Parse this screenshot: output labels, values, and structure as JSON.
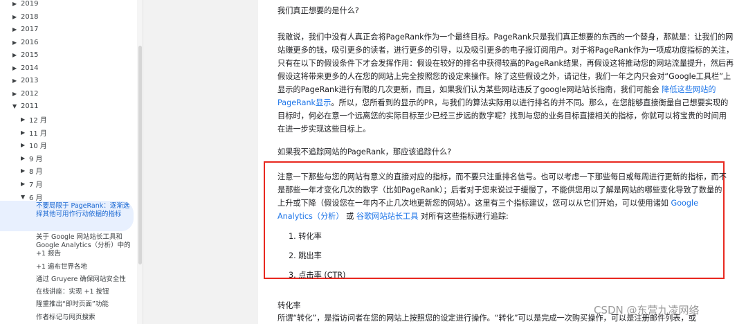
{
  "sidebar": {
    "years": [
      {
        "label": "2019",
        "expanded": false
      },
      {
        "label": "2018",
        "expanded": false
      },
      {
        "label": "2017",
        "expanded": false
      },
      {
        "label": "2016",
        "expanded": false
      },
      {
        "label": "2015",
        "expanded": false
      },
      {
        "label": "2014",
        "expanded": false
      },
      {
        "label": "2013",
        "expanded": false
      },
      {
        "label": "2012",
        "expanded": false
      },
      {
        "label": "2011",
        "expanded": true
      }
    ],
    "months": [
      {
        "label": "12 月",
        "expanded": false
      },
      {
        "label": "11 月",
        "expanded": false
      },
      {
        "label": "10 月",
        "expanded": false
      },
      {
        "label": "9 月",
        "expanded": false
      },
      {
        "label": "8 月",
        "expanded": false
      },
      {
        "label": "7 月",
        "expanded": false
      },
      {
        "label": "6 月",
        "expanded": true
      }
    ],
    "selected_post": "不要局限于 PageRank：逐渐选择其他可用作行动依据的指标",
    "posts": [
      "关于 Google 网站站长工具和 Google Analytics（分析）中的 +1 报告",
      "+1 遍布世界各地",
      "通过 Gruyere 确保网站安全性",
      "在线讲座：实现 +1 按钮",
      "隆重推出“即时页面”功能",
      "作者标记与网页搜索"
    ]
  },
  "article": {
    "heading1": "我们真正想要的是什么?",
    "para1_a": "我敢说，我们中没有人真正会将PageRank作为一个最终目标。PageRank只是我们真正想要的东西的一个替身，那就是：让我们的网站赚更多的钱，吸引更多的读者，进行更多的引导，以及吸引更多的电子报订阅用户。对于将PageRank作为一项成功度指标的关注，只有在以下的假设条件下才会发挥作用：假设在较好的排名中获得较高的PageRank结果，再假设这将推动您的网站流量提升，然后再假设这将带来更多的人在您的网站上完全按照您的设定来操作。除了这些假设之外，请记住，我们一年之内只会对“Google工具栏”上显示的PageRank进行有限的几次更新，而且，如果我们认为某些网站违反了google网站站长指南，我们可能会 ",
    "para1_link": "降低这些网站的PageRank显示",
    "para1_b": "。所以，您所看到的显示的PR，与我们的算法实际用以进行排名的并不同。那么，在您能够直接衡量自己想要实现的目标时，何必在意一个远离您的实际目标至少已经三步远的数字呢？找到与您的业务目标直接相关的指标，你就可以将宝贵的时间用在进一步实现这些目标上。",
    "heading2": "如果我不追踪网站的PageRank，那应该追踪什么?",
    "para2_a": "注意一下那些与您的网站有意义的直接对应的指标，而不要只注重排名信号。也可以考虑一下那些每日或每周进行更新的指标，而不是那些一年才变化几次的数字（比如PageRank）；后者对于您来说过于缓慢了，不能供您用以了解是网站的哪些变化导致了数量的上升或下降（假设您在一年内不止几次地更新您的网站）。这里有三个指标建议，您可以从它们开始，可以使用诸如 ",
    "para2_link1": "Google Analytics（分析）",
    "para2_mid": " 或 ",
    "para2_link2": "谷歌网站站长工具",
    "para2_b": " 对所有这些指标进行追踪:",
    "list": [
      "1. 转化率",
      "2. 跳出率",
      "3. 点击率 (CTR)"
    ],
    "heading3": "转化率",
    "para3": "所谓“转化”，是指访问者在您的网站上按照您的设定进行操作。“转化”可以是完成一次购买操作，可以是注册邮件列表，或"
  },
  "watermark": "CSDN @东营九凌网络",
  "colors": {
    "link": "#1a73e8",
    "highlight_border": "#e8281f",
    "selected_bg": "#e8f0fe",
    "selected_text": "#1967d2"
  }
}
